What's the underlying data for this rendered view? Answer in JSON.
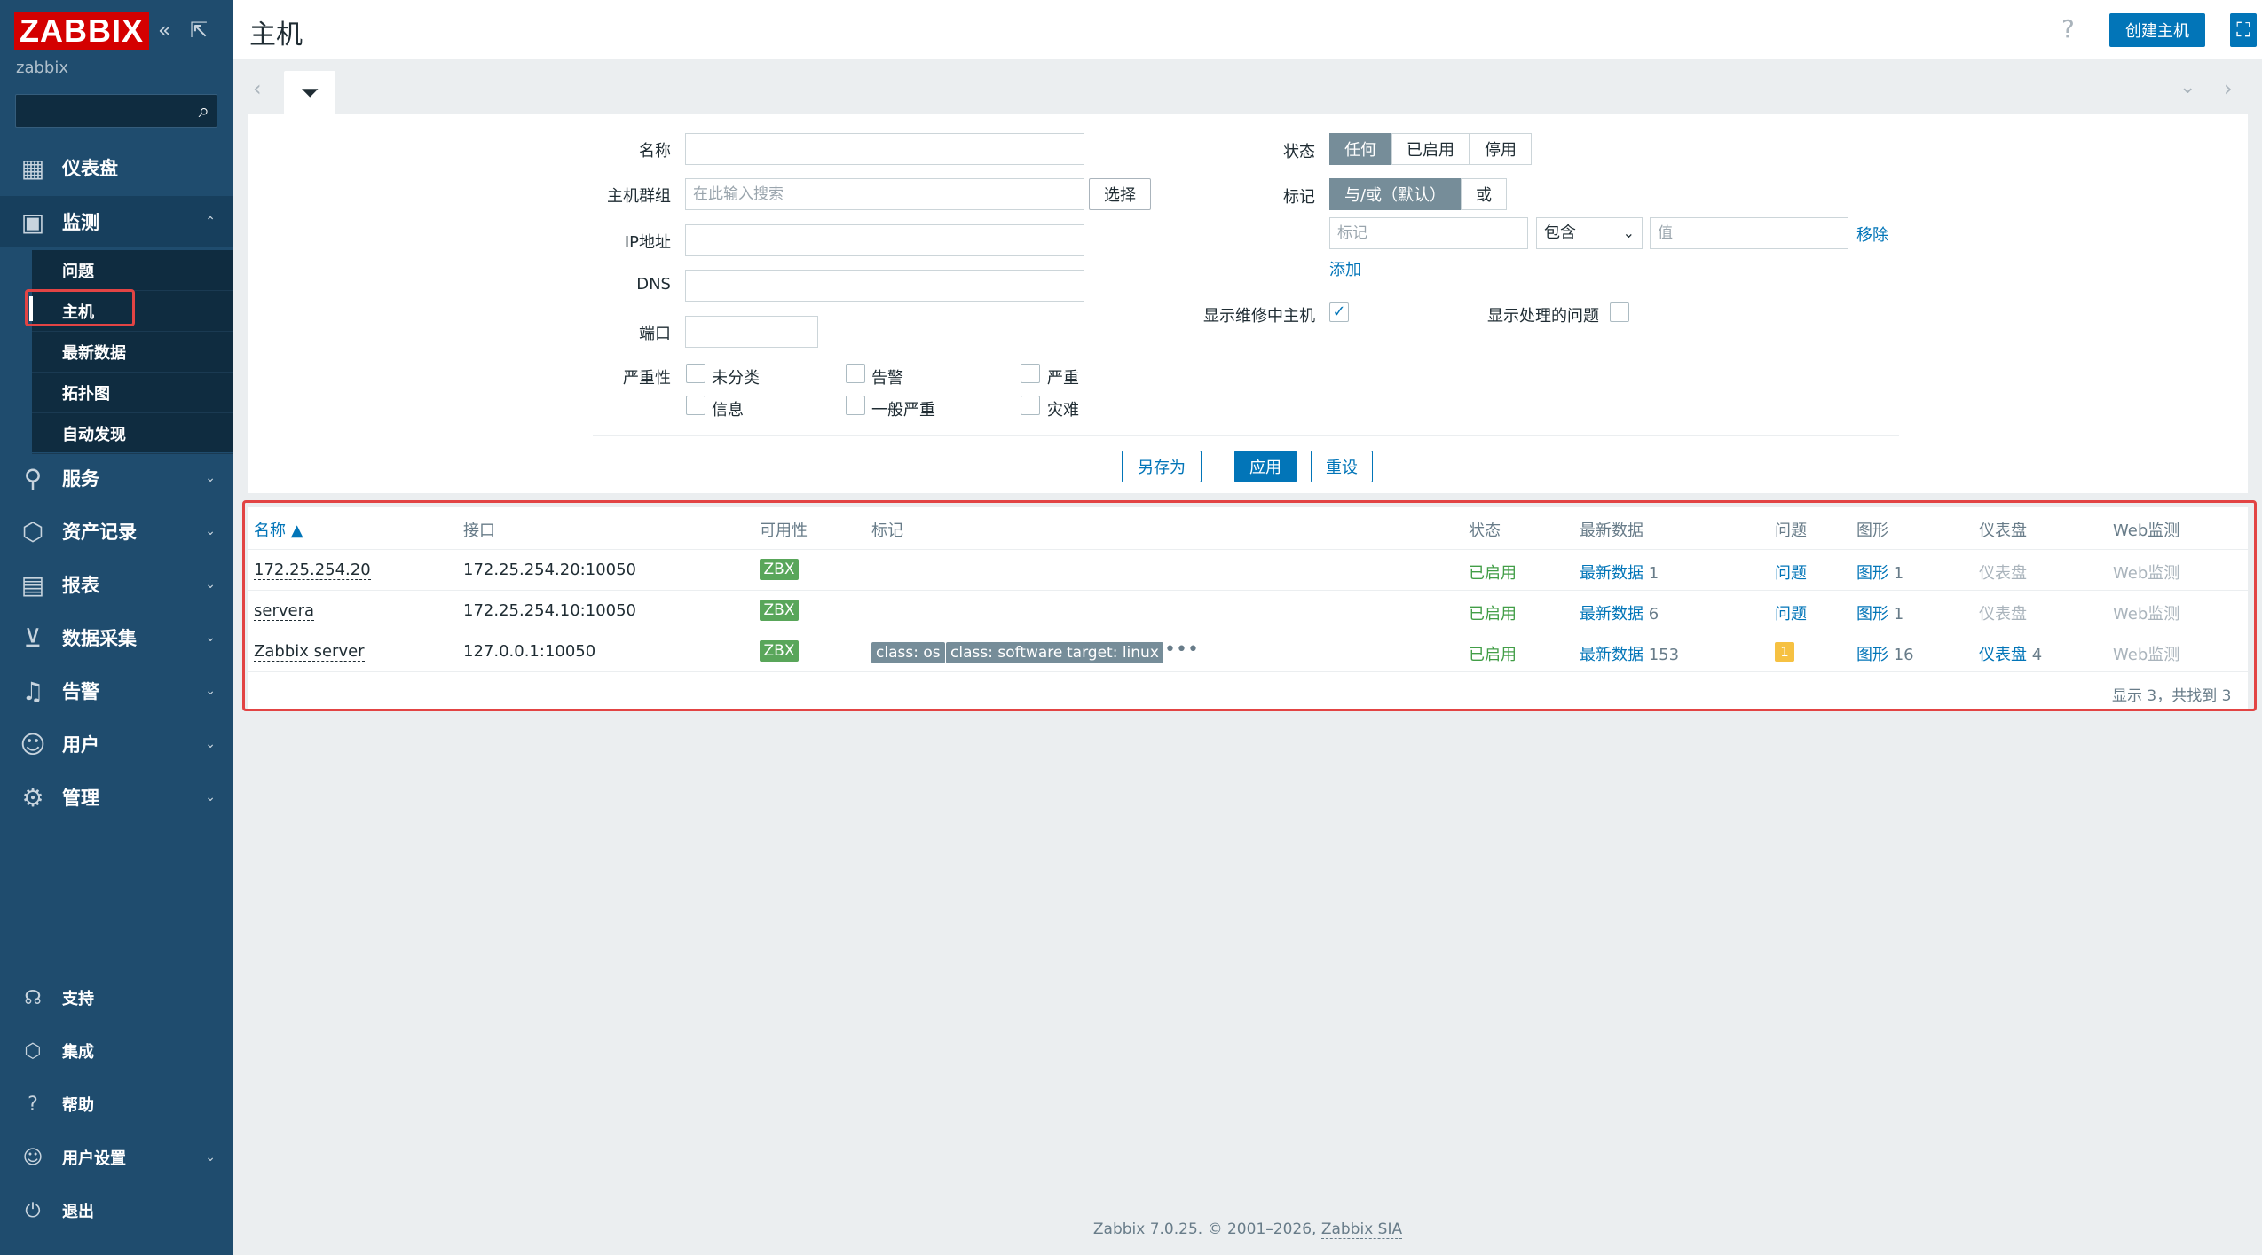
{
  "brand": {
    "logo": "ZABBIX",
    "server_name": "zabbix"
  },
  "sidebar": {
    "main": [
      {
        "label": "仪表盘",
        "icon": "dashboard-icon"
      },
      {
        "label": "监测",
        "icon": "monitoring-icon"
      },
      {
        "label": "服务",
        "icon": "services-icon"
      },
      {
        "label": "资产记录",
        "icon": "inventory-icon"
      },
      {
        "label": "报表",
        "icon": "reports-icon"
      },
      {
        "label": "数据采集",
        "icon": "data-collection-icon"
      },
      {
        "label": "告警",
        "icon": "alerts-icon"
      },
      {
        "label": "用户",
        "icon": "users-icon"
      },
      {
        "label": "管理",
        "icon": "administration-icon"
      }
    ],
    "monitoring_sub": [
      "问题",
      "主机",
      "最新数据",
      "拓扑图",
      "自动发现"
    ],
    "bottom": [
      {
        "label": "支持",
        "icon": "support-icon"
      },
      {
        "label": "集成",
        "icon": "integrations-icon"
      },
      {
        "label": "帮助",
        "icon": "help-icon"
      },
      {
        "label": "用户设置",
        "icon": "user-settings-icon"
      },
      {
        "label": "退出",
        "icon": "signout-icon"
      }
    ]
  },
  "header": {
    "title": "主机",
    "create_label": "创建主机"
  },
  "filter": {
    "name_label": "名称",
    "host_groups_label": "主机群组",
    "host_groups_placeholder": "在此输入搜索",
    "select_label": "选择",
    "ip_label": "IP地址",
    "dns_label": "DNS",
    "port_label": "端口",
    "severity_label": "严重性",
    "severities": [
      "未分类",
      "告警",
      "严重",
      "信息",
      "一般严重",
      "灾难"
    ],
    "status_label": "状态",
    "status_options": [
      "任何",
      "已启用",
      "停用"
    ],
    "status_selected": "任何",
    "tags_label": "标记",
    "tag_ops": [
      "与/或（默认）",
      "或"
    ],
    "tag_placeholder": "标记",
    "tag_operator": "包含",
    "value_placeholder": "值",
    "remove_label": "移除",
    "add_label": "添加",
    "show_maintenance_label": "显示维修中主机",
    "show_maintenance_checked": true,
    "show_suppressed_label": "显示处理的问题",
    "save_as_label": "另存为",
    "apply_label": "应用",
    "reset_label": "重设"
  },
  "table": {
    "columns": [
      "名称 ▲",
      "接口",
      "可用性",
      "标记",
      "状态",
      "最新数据",
      "问题",
      "图形",
      "仪表盘",
      "Web监测"
    ],
    "rows": [
      {
        "name": "172.25.254.20",
        "interface": "172.25.254.20:10050",
        "availability": "ZBX",
        "tags": [],
        "status": "已启用",
        "latest": "最新数据",
        "latest_count": "1",
        "problems": "问题",
        "graphs": "图形",
        "graphs_count": "1",
        "dashboards": "仪表盘",
        "dashboards_count": "",
        "web": "Web监测"
      },
      {
        "name": "servera",
        "interface": "172.25.254.10:10050",
        "availability": "ZBX",
        "tags": [],
        "status": "已启用",
        "latest": "最新数据",
        "latest_count": "6",
        "problems": "问题",
        "graphs": "图形",
        "graphs_count": "1",
        "dashboards": "仪表盘",
        "dashboards_count": "",
        "web": "Web监测"
      },
      {
        "name": "Zabbix server",
        "interface": "127.0.0.1:10050",
        "availability": "ZBX",
        "tags": [
          "class: os",
          "class: software",
          "target: linux"
        ],
        "status": "已启用",
        "latest": "最新数据",
        "latest_count": "153",
        "problems_badge": "1",
        "graphs": "图形",
        "graphs_count": "16",
        "dashboards": "仪表盘",
        "dashboards_count": "4",
        "web": "Web监测"
      }
    ],
    "stats": "显示 3，共找到 3"
  },
  "footer": {
    "text": "Zabbix 7.0.25. © 2001–2026, ",
    "link": "Zabbix SIA"
  },
  "colors": {
    "sidebar": "#1f4c6e",
    "accent": "#0275b8",
    "logo": "#d40000",
    "enabled": "#429e47",
    "highlight": "#e24444"
  }
}
